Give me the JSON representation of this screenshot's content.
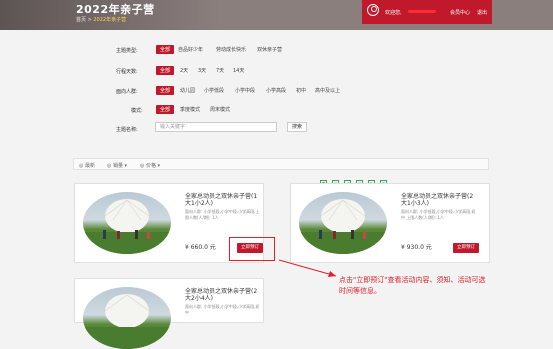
{
  "header": {
    "title": "2022年亲子营",
    "breadcrumb_home": "首页 >",
    "breadcrumb_current": "2022年亲子营",
    "welcome": "欢迎您,",
    "member_center": "会员中心",
    "logout": "退出"
  },
  "filters": [
    {
      "label": "主题类型:",
      "options": [
        "全部",
        "自品好少年",
        "劳动成长快乐",
        "双休亲子营"
      ],
      "selected": "全部"
    },
    {
      "label": "行程天数:",
      "options": [
        "全部",
        "2天",
        "3天",
        "7天",
        "14天"
      ],
      "selected": "全部"
    },
    {
      "label": "面向人群:",
      "options": [
        "全部",
        "幼儿园",
        "小学低段",
        "小学中段",
        "小学高段",
        "初中",
        "高中及以上"
      ],
      "selected": "全部"
    },
    {
      "label": "模式:",
      "options": [
        "全部",
        "季度模式",
        "周末模式"
      ],
      "selected": "全部"
    },
    {
      "label": "主题名称:",
      "options": [],
      "selected": ""
    }
  ],
  "search": {
    "placeholder": "输入关键字",
    "button": "搜索"
  },
  "sort_bar": {
    "items": [
      "◎ 最新",
      "◎ 销量 ▾",
      "◎ 价格 ▾"
    ]
  },
  "cards": [
    {
      "title": "全家总动员之双休亲子营(1大1小2人)",
      "desc": "面向人群: 小学低段,小学中段,小学高段,上限人数(人/期): 1人",
      "price": "¥ 660.0 元",
      "button": "立即预订"
    },
    {
      "title": "全家总动员之双休亲子营(2大1小3人)",
      "desc": "面向人群: 小学低段,小学中段,小学高段,初中 上限人数(人/期): 1人",
      "price": "¥ 930.0 元",
      "button": "立即预订"
    },
    {
      "title": "全家总动员之双休亲子营(2大2小4人)",
      "desc": "面向人群: 小学低段,小学中段,小学高段,初中",
      "price": "",
      "button": ""
    }
  ],
  "annotation": {
    "text": "点击\"立即预订\"查看活动内容、须知、活动可选时间等信息。"
  },
  "colors": {
    "accent": "#c0192b",
    "annotation": "#e0202a"
  }
}
